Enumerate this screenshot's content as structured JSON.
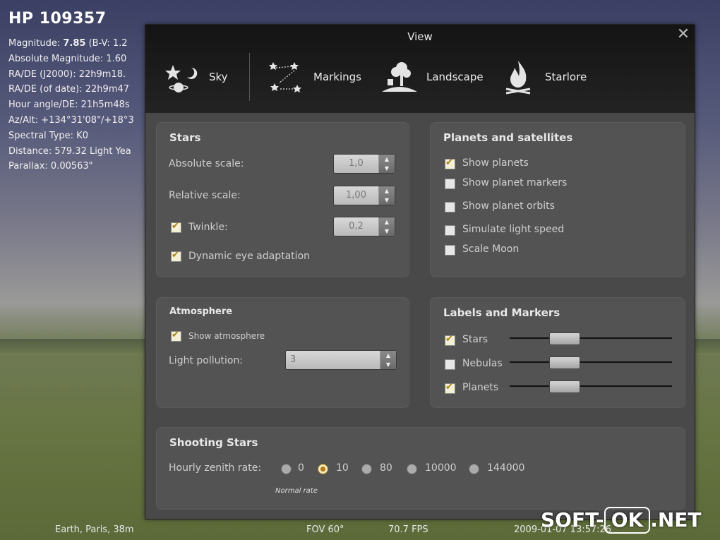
{
  "info": {
    "name": "HP 109357",
    "lines": [
      {
        "label": "Magnitude: ",
        "value_bold": "7.85",
        "rest": " (B-V: 1.2"
      },
      {
        "text": "Absolute Magnitude: 1.60"
      },
      {
        "text": "RA/DE (J2000): 22h9m18."
      },
      {
        "text": "RA/DE (of date): 22h9m47"
      },
      {
        "text": "Hour angle/DE: 21h5m48s"
      },
      {
        "text": "Az/Alt: +134°31'08\"/+18°3"
      },
      {
        "text": "Spectral Type: K0"
      },
      {
        "text": "Distance: 579.32 Light Yea"
      },
      {
        "text": "Parallax: 0.00563\""
      }
    ]
  },
  "dialog": {
    "title": "View",
    "close_icon": "close-icon",
    "tabs": [
      {
        "label": "Sky",
        "icon": "sky-icon"
      },
      {
        "label": "Markings",
        "icon": "markings-icon"
      },
      {
        "label": "Landscape",
        "icon": "landscape-icon"
      },
      {
        "label": "Starlore",
        "icon": "starlore-icon"
      }
    ],
    "stars": {
      "title": "Stars",
      "absolute_scale_label": "Absolute scale:",
      "absolute_scale_value": "1,0",
      "relative_scale_label": "Relative scale:",
      "relative_scale_value": "1,00",
      "twinkle_label": "Twinkle:",
      "twinkle_checked": true,
      "twinkle_value": "0,2",
      "eye_adapt_label": "Dynamic eye adaptation",
      "eye_adapt_checked": true
    },
    "planets": {
      "title": "Planets and satellites",
      "items": [
        {
          "label": "Show planets",
          "checked": true
        },
        {
          "label": "Show planet markers",
          "checked": false
        },
        {
          "label": "Show planet orbits",
          "checked": false
        },
        {
          "label": "Simulate light speed",
          "checked": false
        },
        {
          "label": "Scale Moon",
          "checked": false
        }
      ]
    },
    "atmosphere": {
      "title": "Atmosphere",
      "show_label": "Show atmosphere",
      "show_checked": true,
      "pollution_label": "Light pollution:",
      "pollution_value": "3"
    },
    "labels": {
      "title": "Labels and Markers",
      "items": [
        {
          "label": "Stars",
          "checked": true,
          "level": 0.35
        },
        {
          "label": "Nebulas",
          "checked": false,
          "level": 0.35
        },
        {
          "label": "Planets",
          "checked": true,
          "level": 0.35
        }
      ]
    },
    "shooting": {
      "title": "Shooting Stars",
      "rate_label": "Hourly zenith rate:",
      "options": [
        "0",
        "10",
        "80",
        "10000",
        "144000"
      ],
      "selected": "10",
      "normal_rate_label": "Normal rate"
    }
  },
  "status": {
    "location": "Earth, Paris, 38m",
    "fov": "FOV 60°",
    "fps": "70.7 FPS",
    "datetime": "2009-01-07  13:57:26"
  },
  "watermark": {
    "left": "SOFT-",
    "mid": "OK",
    "right": ".NET"
  }
}
